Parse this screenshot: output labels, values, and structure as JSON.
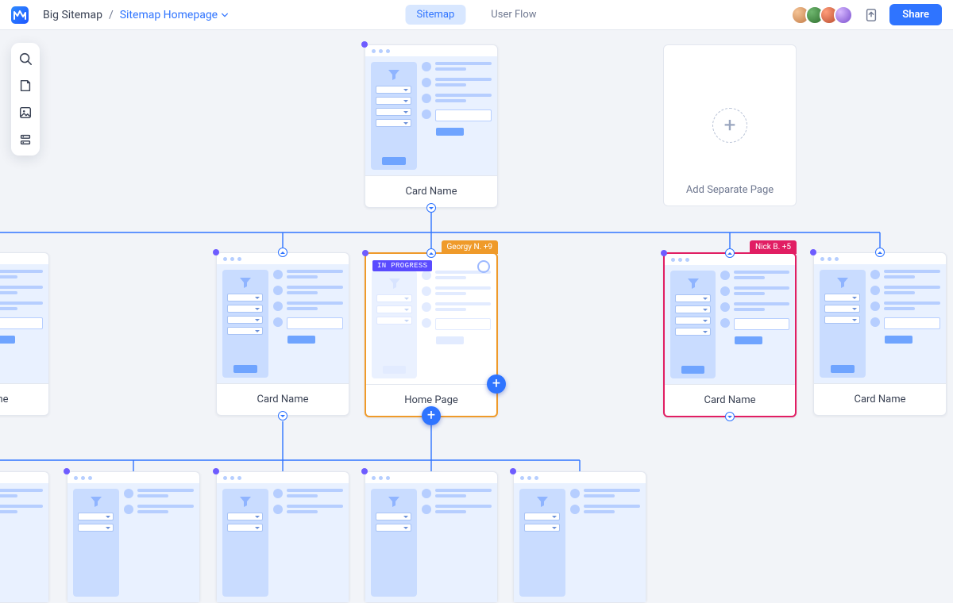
{
  "header": {
    "project_name": "Big Sitemap",
    "breadcrumb_separator": "/",
    "breadcrumb_link": "Sitemap Homepage",
    "tabs": {
      "sitemap": "Sitemap",
      "userflow": "User Flow"
    },
    "share_label": "Share"
  },
  "add_card": {
    "label": "Add Separate Page"
  },
  "cards": {
    "root": {
      "title": "Card Name"
    },
    "l2_left_edge": {
      "title": "Card Name"
    },
    "l2_a": {
      "title": "Card Name"
    },
    "l2_home": {
      "title": "Home Page",
      "status": "IN PROGRESS",
      "tag": "Georgy N. +9"
    },
    "l2_c": {
      "title": "Card Name",
      "tag": "Nick B. +5"
    },
    "l2_right_edge": {
      "title": "Card Name"
    }
  },
  "colors": {
    "blue": "#2f74ff",
    "orange": "#ef9a2a",
    "magenta": "#e11e63",
    "status_badge": "#5a4bff"
  }
}
